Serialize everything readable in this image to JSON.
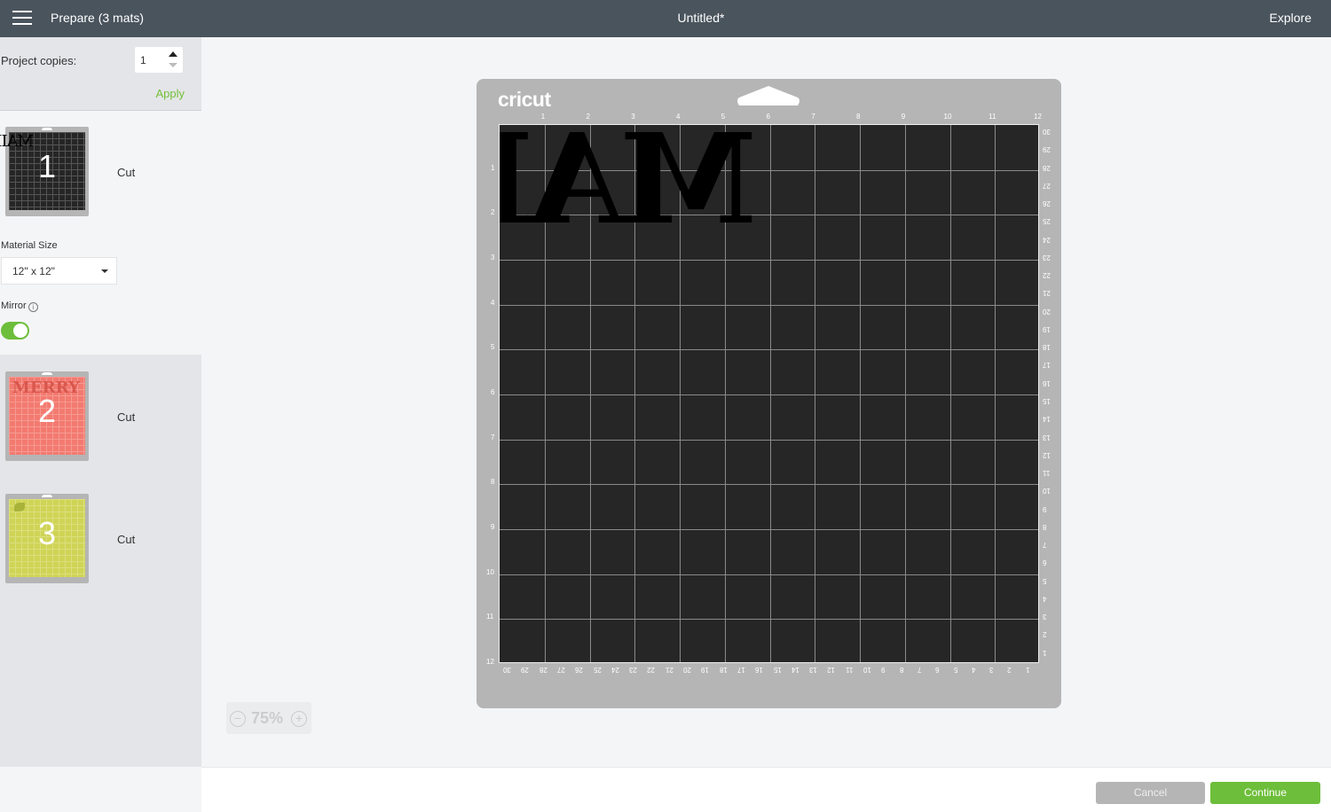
{
  "topbar": {
    "title": "Prepare (3 mats)",
    "document_title": "Untitled*",
    "explore_label": "Explore"
  },
  "sidebar": {
    "project_copies_label": "Project copies:",
    "project_copies_value": "1",
    "apply_label": "Apply",
    "material_size_label": "Material Size",
    "material_size_value": "12\" x 12\"",
    "mirror_label": "Mirror",
    "mirror_on": true,
    "mats": [
      {
        "number": "1",
        "action": "Cut",
        "color": "#262626",
        "preview_text": "MAIL"
      },
      {
        "number": "2",
        "action": "Cut",
        "color": "#f37a70",
        "preview_text": "MERRY"
      },
      {
        "number": "3",
        "action": "Cut",
        "color": "#cfd456",
        "preview_text": ""
      }
    ]
  },
  "canvas": {
    "brand": "cricut",
    "design_text": "MAIL",
    "top_ruler": [
      "1",
      "2",
      "3",
      "4",
      "5",
      "6",
      "7",
      "8",
      "9",
      "10",
      "11",
      "12"
    ],
    "left_ruler": [
      "1",
      "2",
      "3",
      "4",
      "5",
      "6",
      "7",
      "8",
      "9",
      "10",
      "11",
      "12"
    ],
    "right_ruler_cm": [
      "30",
      "29",
      "28",
      "27",
      "26",
      "25",
      "24",
      "23",
      "22",
      "21",
      "20",
      "19",
      "18",
      "17",
      "16",
      "15",
      "14",
      "13",
      "12",
      "11",
      "10",
      "9",
      "8",
      "7",
      "6",
      "5",
      "4",
      "3",
      "2",
      "1"
    ],
    "bottom_ruler_cm": [
      "30",
      "29",
      "28",
      "27",
      "26",
      "25",
      "24",
      "23",
      "22",
      "21",
      "20",
      "19",
      "18",
      "17",
      "16",
      "15",
      "14",
      "13",
      "12",
      "11",
      "10",
      "9",
      "8",
      "7",
      "6",
      "5",
      "4",
      "3",
      "2",
      "1"
    ]
  },
  "zoom": {
    "level": "75%",
    "minus": "−",
    "plus": "+"
  },
  "footer": {
    "cancel_label": "Cancel",
    "continue_label": "Continue"
  }
}
